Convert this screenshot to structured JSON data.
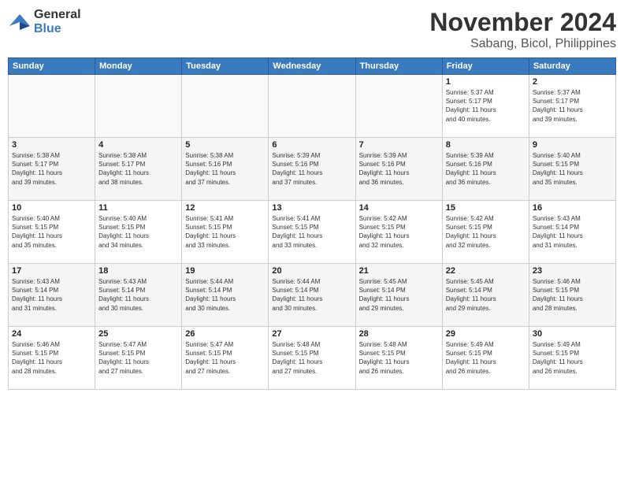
{
  "header": {
    "logo_general": "General",
    "logo_blue": "Blue",
    "main_title": "November 2024",
    "subtitle": "Sabang, Bicol, Philippines"
  },
  "weekdays": [
    "Sunday",
    "Monday",
    "Tuesday",
    "Wednesday",
    "Thursday",
    "Friday",
    "Saturday"
  ],
  "weeks": [
    [
      {
        "day": "",
        "detail": ""
      },
      {
        "day": "",
        "detail": ""
      },
      {
        "day": "",
        "detail": ""
      },
      {
        "day": "",
        "detail": ""
      },
      {
        "day": "",
        "detail": ""
      },
      {
        "day": "1",
        "detail": "Sunrise: 5:37 AM\nSunset: 5:17 PM\nDaylight: 11 hours\nand 40 minutes."
      },
      {
        "day": "2",
        "detail": "Sunrise: 5:37 AM\nSunset: 5:17 PM\nDaylight: 11 hours\nand 39 minutes."
      }
    ],
    [
      {
        "day": "3",
        "detail": "Sunrise: 5:38 AM\nSunset: 5:17 PM\nDaylight: 11 hours\nand 39 minutes."
      },
      {
        "day": "4",
        "detail": "Sunrise: 5:38 AM\nSunset: 5:17 PM\nDaylight: 11 hours\nand 38 minutes."
      },
      {
        "day": "5",
        "detail": "Sunrise: 5:38 AM\nSunset: 5:16 PM\nDaylight: 11 hours\nand 37 minutes."
      },
      {
        "day": "6",
        "detail": "Sunrise: 5:39 AM\nSunset: 5:16 PM\nDaylight: 11 hours\nand 37 minutes."
      },
      {
        "day": "7",
        "detail": "Sunrise: 5:39 AM\nSunset: 5:16 PM\nDaylight: 11 hours\nand 36 minutes."
      },
      {
        "day": "8",
        "detail": "Sunrise: 5:39 AM\nSunset: 5:16 PM\nDaylight: 11 hours\nand 36 minutes."
      },
      {
        "day": "9",
        "detail": "Sunrise: 5:40 AM\nSunset: 5:15 PM\nDaylight: 11 hours\nand 35 minutes."
      }
    ],
    [
      {
        "day": "10",
        "detail": "Sunrise: 5:40 AM\nSunset: 5:15 PM\nDaylight: 11 hours\nand 35 minutes."
      },
      {
        "day": "11",
        "detail": "Sunrise: 5:40 AM\nSunset: 5:15 PM\nDaylight: 11 hours\nand 34 minutes."
      },
      {
        "day": "12",
        "detail": "Sunrise: 5:41 AM\nSunset: 5:15 PM\nDaylight: 11 hours\nand 33 minutes."
      },
      {
        "day": "13",
        "detail": "Sunrise: 5:41 AM\nSunset: 5:15 PM\nDaylight: 11 hours\nand 33 minutes."
      },
      {
        "day": "14",
        "detail": "Sunrise: 5:42 AM\nSunset: 5:15 PM\nDaylight: 11 hours\nand 32 minutes."
      },
      {
        "day": "15",
        "detail": "Sunrise: 5:42 AM\nSunset: 5:15 PM\nDaylight: 11 hours\nand 32 minutes."
      },
      {
        "day": "16",
        "detail": "Sunrise: 5:43 AM\nSunset: 5:14 PM\nDaylight: 11 hours\nand 31 minutes."
      }
    ],
    [
      {
        "day": "17",
        "detail": "Sunrise: 5:43 AM\nSunset: 5:14 PM\nDaylight: 11 hours\nand 31 minutes."
      },
      {
        "day": "18",
        "detail": "Sunrise: 5:43 AM\nSunset: 5:14 PM\nDaylight: 11 hours\nand 30 minutes."
      },
      {
        "day": "19",
        "detail": "Sunrise: 5:44 AM\nSunset: 5:14 PM\nDaylight: 11 hours\nand 30 minutes."
      },
      {
        "day": "20",
        "detail": "Sunrise: 5:44 AM\nSunset: 5:14 PM\nDaylight: 11 hours\nand 30 minutes."
      },
      {
        "day": "21",
        "detail": "Sunrise: 5:45 AM\nSunset: 5:14 PM\nDaylight: 11 hours\nand 29 minutes."
      },
      {
        "day": "22",
        "detail": "Sunrise: 5:45 AM\nSunset: 5:14 PM\nDaylight: 11 hours\nand 29 minutes."
      },
      {
        "day": "23",
        "detail": "Sunrise: 5:46 AM\nSunset: 5:15 PM\nDaylight: 11 hours\nand 28 minutes."
      }
    ],
    [
      {
        "day": "24",
        "detail": "Sunrise: 5:46 AM\nSunset: 5:15 PM\nDaylight: 11 hours\nand 28 minutes."
      },
      {
        "day": "25",
        "detail": "Sunrise: 5:47 AM\nSunset: 5:15 PM\nDaylight: 11 hours\nand 27 minutes."
      },
      {
        "day": "26",
        "detail": "Sunrise: 5:47 AM\nSunset: 5:15 PM\nDaylight: 11 hours\nand 27 minutes."
      },
      {
        "day": "27",
        "detail": "Sunrise: 5:48 AM\nSunset: 5:15 PM\nDaylight: 11 hours\nand 27 minutes."
      },
      {
        "day": "28",
        "detail": "Sunrise: 5:48 AM\nSunset: 5:15 PM\nDaylight: 11 hours\nand 26 minutes."
      },
      {
        "day": "29",
        "detail": "Sunrise: 5:49 AM\nSunset: 5:15 PM\nDaylight: 11 hours\nand 26 minutes."
      },
      {
        "day": "30",
        "detail": "Sunrise: 5:49 AM\nSunset: 5:15 PM\nDaylight: 11 hours\nand 26 minutes."
      }
    ]
  ]
}
